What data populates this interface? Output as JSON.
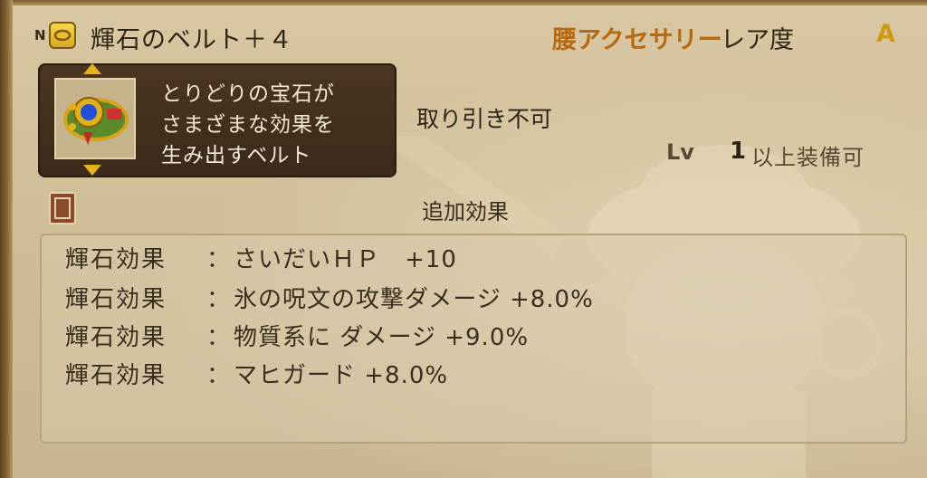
{
  "item": {
    "rank_mark": "N",
    "icon": "belt-icon",
    "name": "輝石のベルト＋４",
    "slot": "腰アクセサリー",
    "rarity_label": "レア度",
    "rarity": "A"
  },
  "description": {
    "lines": [
      "とりどりの宝石が",
      "さまざまな効果を",
      "生み出すベルト"
    ]
  },
  "trade_status": "取り引き不可",
  "level": {
    "label": "Lv",
    "value": "1",
    "suffix": "以上装備可"
  },
  "effects": {
    "title": "追加効果",
    "rows": [
      {
        "label": "輝石効果",
        "colon": "：",
        "value": "さいだいＨＰ　+10"
      },
      {
        "label": "輝石効果",
        "colon": "：",
        "value": "氷の呪文の攻撃ダメージ +8.0%"
      },
      {
        "label": "輝石効果",
        "colon": "：",
        "value": "物質系に ダメージ +9.0%"
      },
      {
        "label": "輝石効果",
        "colon": "：",
        "value": "マヒガード +8.0%"
      }
    ]
  },
  "colors": {
    "slot_text": "#b8680e",
    "rarity_text": "#d09a10",
    "description_bg": "#3b2a1a"
  }
}
